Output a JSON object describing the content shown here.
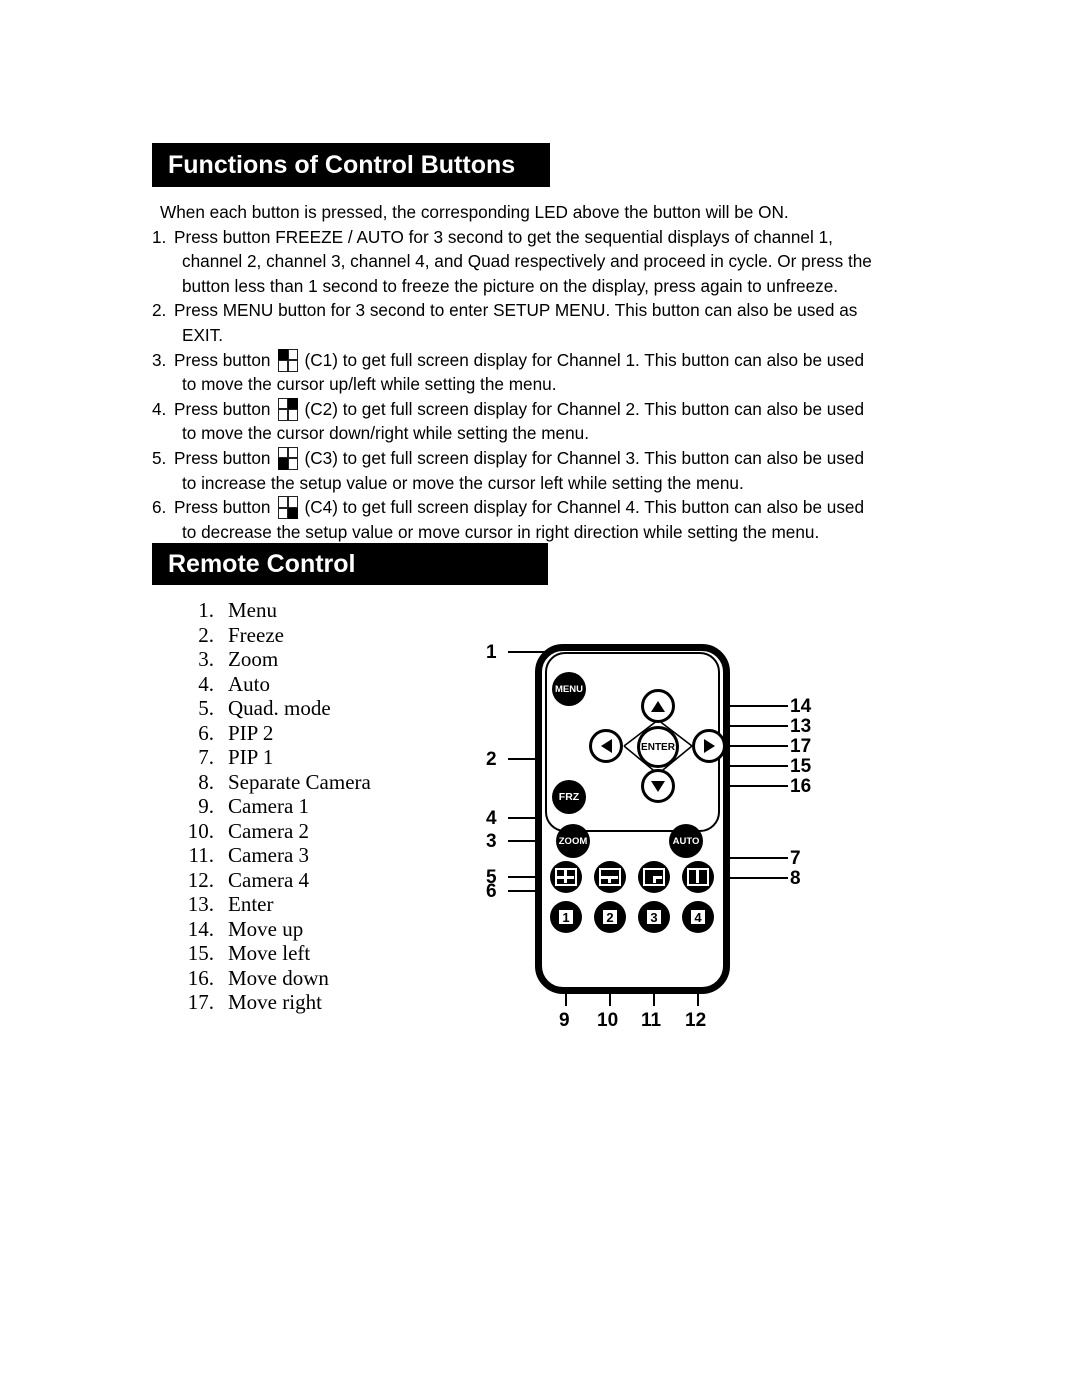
{
  "sections": {
    "functions": {
      "bar_title": "Functions of Control Buttons",
      "intro": "When each button is pressed, the corresponding LED above the button will be ON.",
      "items": [
        {
          "num": "1.",
          "line1": "Press button FREEZE / AUTO for 3 second to get the sequential displays of channel 1,",
          "line2": "channel 2, channel 3, channel 4, and Quad respectively and proceed in cycle. Or press the",
          "line3": "button less than 1 second to freeze the picture on the display, press again to unfreeze.",
          "icon": null
        },
        {
          "num": "2.",
          "line1": "Press MENU button for 3 second to enter SETUP MENU. This button can also be used as",
          "line2": "EXIT.",
          "line3": null,
          "icon": null
        },
        {
          "num": "3.",
          "pre": "Press button",
          "post": "(C1) to get full screen display for Channel 1. This button can also be used",
          "line2": "to move the cursor up/left while setting the menu.",
          "icon": "quad-icon-top-left"
        },
        {
          "num": "4.",
          "pre": "Press button",
          "post": "(C2) to get full screen display for Channel 2. This button can also be used",
          "line2": "to move the cursor down/right while setting the menu.",
          "icon": "quad-icon-top-right"
        },
        {
          "num": "5.",
          "pre": "Press button",
          "post": "(C3) to get full screen display for Channel 3.   This button can also be used",
          "line2": "to increase the setup value or move the cursor left while setting the menu.",
          "icon": "quad-icon-bottom-left"
        },
        {
          "num": "6.",
          "pre": "Press button",
          "post": "(C4) to get full screen display for Channel 4. This button can also be used",
          "line2": "to decrease the setup value or move cursor in right direction while setting the menu.",
          "icon": "quad-icon-bottom-right"
        }
      ]
    },
    "remote": {
      "bar_title": "Remote Control",
      "legend": [
        {
          "num": "1.",
          "label": "Menu"
        },
        {
          "num": "2.",
          "label": "Freeze"
        },
        {
          "num": "3.",
          "label": "Zoom"
        },
        {
          "num": "4.",
          "label": "Auto"
        },
        {
          "num": "5.",
          "label": "Quad. mode"
        },
        {
          "num": "6.",
          "label": "PIP 2"
        },
        {
          "num": "7.",
          "label": "PIP 1"
        },
        {
          "num": "8.",
          "label": "Separate Camera"
        },
        {
          "num": "9.",
          "label": "Camera 1"
        },
        {
          "num": "10.",
          "label": "Camera 2"
        },
        {
          "num": "11.",
          "label": "Camera 3"
        },
        {
          "num": "12.",
          "label": "Camera 4"
        },
        {
          "num": "13.",
          "label": "Enter"
        },
        {
          "num": "14.",
          "label": "Move up"
        },
        {
          "num": "15.",
          "label": "Move left"
        },
        {
          "num": "16.",
          "label": "Move down"
        },
        {
          "num": "17.",
          "label": "Move right"
        }
      ],
      "figure": {
        "buttons": {
          "menu": "MENU",
          "frz": "FRZ",
          "zoom": "ZOOM",
          "auto": "AUTO",
          "enter": "ENTER",
          "up": "up-arrow-icon",
          "down": "down-arrow-icon",
          "left": "left-arrow-icon",
          "right": "right-arrow-icon",
          "quad_mode": "quad-layout-icon",
          "pip2": "pip2-layout-icon",
          "pip1": "pip1-layout-icon",
          "separate": "separate-layout-icon",
          "cam1": "1",
          "cam2": "2",
          "cam3": "3",
          "cam4": "4"
        },
        "callouts": {
          "left": [
            "1",
            "2",
            "4",
            "3",
            "5",
            "6"
          ],
          "right_top": [
            "14",
            "13",
            "17",
            "15",
            "16"
          ],
          "right_bottom": [
            "7",
            "8"
          ],
          "bottom": [
            "9",
            "10",
            "11",
            "12"
          ]
        }
      }
    }
  },
  "colors": {
    "ink": "#000000",
    "paper": "#ffffff",
    "bar_bg": "#000000",
    "bar_text": "#ffffff"
  }
}
